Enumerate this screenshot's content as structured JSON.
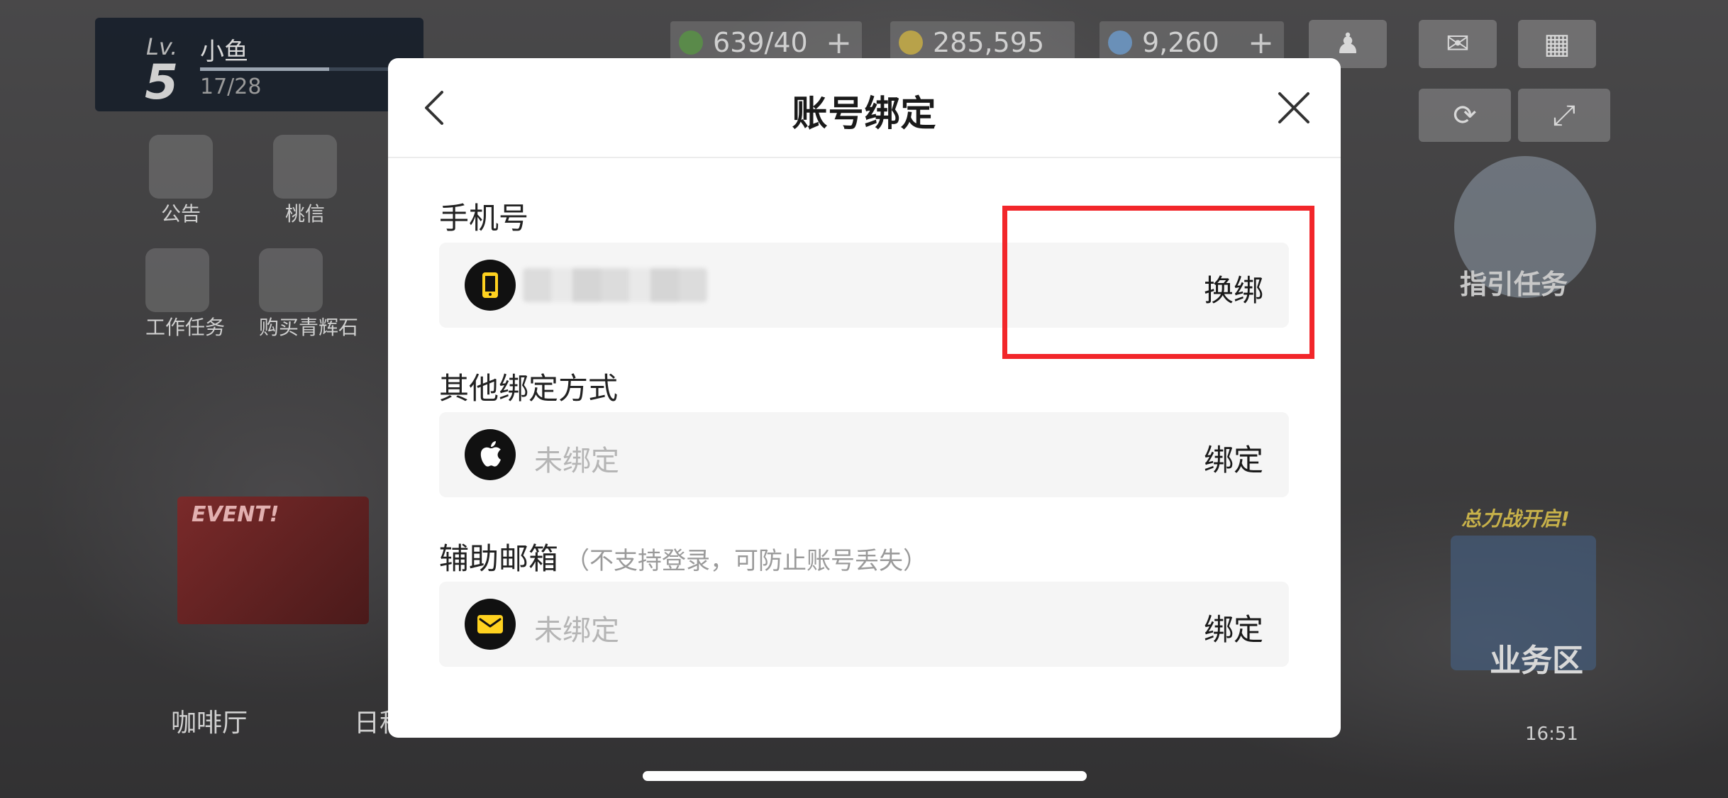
{
  "hud": {
    "level_label": "Lv.",
    "level": "5",
    "player_name": "小鱼",
    "xp": "17/28",
    "xp_progress": 0.607,
    "stamina": "639/40",
    "credits": "285,595",
    "gems": "9,260",
    "plus": "+",
    "side_items": [
      "公告",
      "桃信",
      "工作任务",
      "购买青辉石"
    ],
    "event_banner": "EVENT!",
    "guide_task": "指引任务",
    "total_war_tag": "总力战开启!",
    "business_area": "业务区",
    "bottom_nav": [
      "咖啡厅",
      "日程"
    ],
    "clock": "16:51"
  },
  "dialog": {
    "title": "账号绑定",
    "phone": {
      "label": "手机号",
      "action": "换绑"
    },
    "other": {
      "label": "其他绑定方式",
      "apple_value": "未绑定",
      "apple_action": "绑定"
    },
    "email": {
      "label": "辅助邮箱",
      "note": "（不支持登录，可防止账号丢失）",
      "value": "未绑定",
      "action": "绑定"
    }
  },
  "colors": {
    "highlight": "#f2262a",
    "mail_icon": "#ffd21f"
  }
}
